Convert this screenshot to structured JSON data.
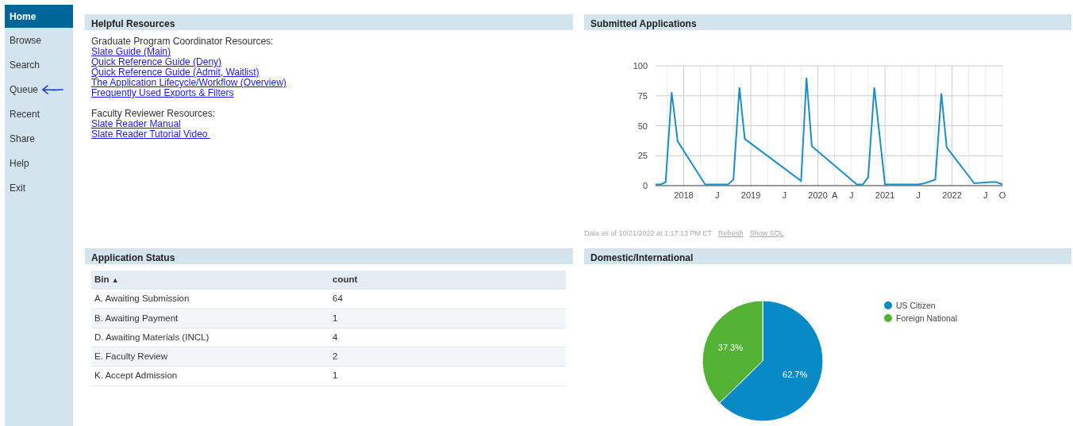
{
  "sidebar": {
    "items": [
      {
        "label": "Home",
        "selected": true
      },
      {
        "label": "Browse",
        "selected": false
      },
      {
        "label": "Search",
        "selected": false
      },
      {
        "label": "Queue",
        "selected": false
      },
      {
        "label": "Recent",
        "selected": false
      },
      {
        "label": "Share",
        "selected": false
      },
      {
        "label": "Help",
        "selected": false
      },
      {
        "label": "Exit",
        "selected": false
      }
    ]
  },
  "helpful_resources": {
    "title": "Helpful Resources",
    "groups": [
      {
        "heading": "Graduate Program Coordinator Resources:",
        "links": [
          "Slate Guide (Main)",
          "Quick Reference Guide (Deny)",
          "Quick Reference Guide (Admit, Waitlist)",
          "The Application Lifecycle/Workflow (Overview)",
          "Frequently Used Exports & Filters"
        ]
      },
      {
        "heading": "Faculty Reviewer Resources:",
        "links": [
          "Slate Reader Manual",
          "Slate Reader Tutorial Video "
        ]
      }
    ]
  },
  "submitted_applications": {
    "title": "Submitted Applications",
    "chart_data": {
      "type": "line",
      "x": [
        2017.58,
        2017.66,
        2017.73,
        2017.82,
        2017.91,
        2018.32,
        2018.66,
        2018.74,
        2018.83,
        2018.91,
        2019.75,
        2019.83,
        2019.91,
        2020.58,
        2020.67,
        2020.75,
        2020.84,
        2021.0,
        2021.5,
        2021.59,
        2021.75,
        2021.84,
        2021.92,
        2022.33,
        2022.58,
        2022.66,
        2022.75
      ],
      "grid": true,
      "series": [
        {
          "color": "#1a8fc7",
          "values": [
            1,
            1,
            3,
            78,
            37,
            1,
            1,
            5,
            82,
            39,
            4,
            90,
            33,
            1,
            1,
            7,
            82,
            1,
            1,
            2,
            5,
            77,
            32,
            2,
            3,
            3,
            1
          ]
        }
      ],
      "xlim": [
        2017.58,
        2022.75
      ],
      "ylim": [
        0,
        100
      ],
      "yticks": [
        0,
        25,
        50,
        75,
        100
      ],
      "xticks": [
        {
          "value": 2018,
          "label": "2018"
        },
        {
          "value": 2018.5,
          "label": "J"
        },
        {
          "value": 2019,
          "label": "2019"
        },
        {
          "value": 2019.5,
          "label": "J"
        },
        {
          "value": 2020,
          "label": "2020"
        },
        {
          "value": 2020.25,
          "label": "A"
        },
        {
          "value": 2020.5,
          "label": "J"
        },
        {
          "value": 2021,
          "label": "2021"
        },
        {
          "value": 2021.5,
          "label": "J"
        },
        {
          "value": 2022,
          "label": "2022"
        },
        {
          "value": 2022.5,
          "label": "J"
        },
        {
          "value": 2022.75,
          "label": "O"
        }
      ]
    },
    "data_as_of": "Data as of 10/21/2022 at 1:17:13 PM ET",
    "links": [
      "Refresh",
      "Show SQL"
    ]
  },
  "application_status": {
    "title": "Application Status",
    "table": {
      "columns": [
        {
          "label": "Bin",
          "sort_indicator": "▲"
        },
        {
          "label": "count"
        }
      ],
      "rows": [
        [
          "A. Awaiting Submission",
          "64"
        ],
        [
          "B. Awaiting Payment",
          "1"
        ],
        [
          "D. Awaiting Materials (INCL)",
          "4"
        ],
        [
          "E. Faculty Review",
          "2"
        ],
        [
          "K. Accept Admission",
          "1"
        ]
      ]
    }
  },
  "domestic_international": {
    "title": "Domestic/International",
    "chart_data": {
      "type": "pie",
      "categories": [
        "US Citizen",
        "Foreign National"
      ],
      "legend": true,
      "series": [
        {
          "values": [
            62.7,
            37.3
          ]
        }
      ],
      "colors": [
        "#078ac5",
        "#52b234"
      ],
      "value_labels": [
        "62.7%",
        "37.3%"
      ]
    }
  }
}
